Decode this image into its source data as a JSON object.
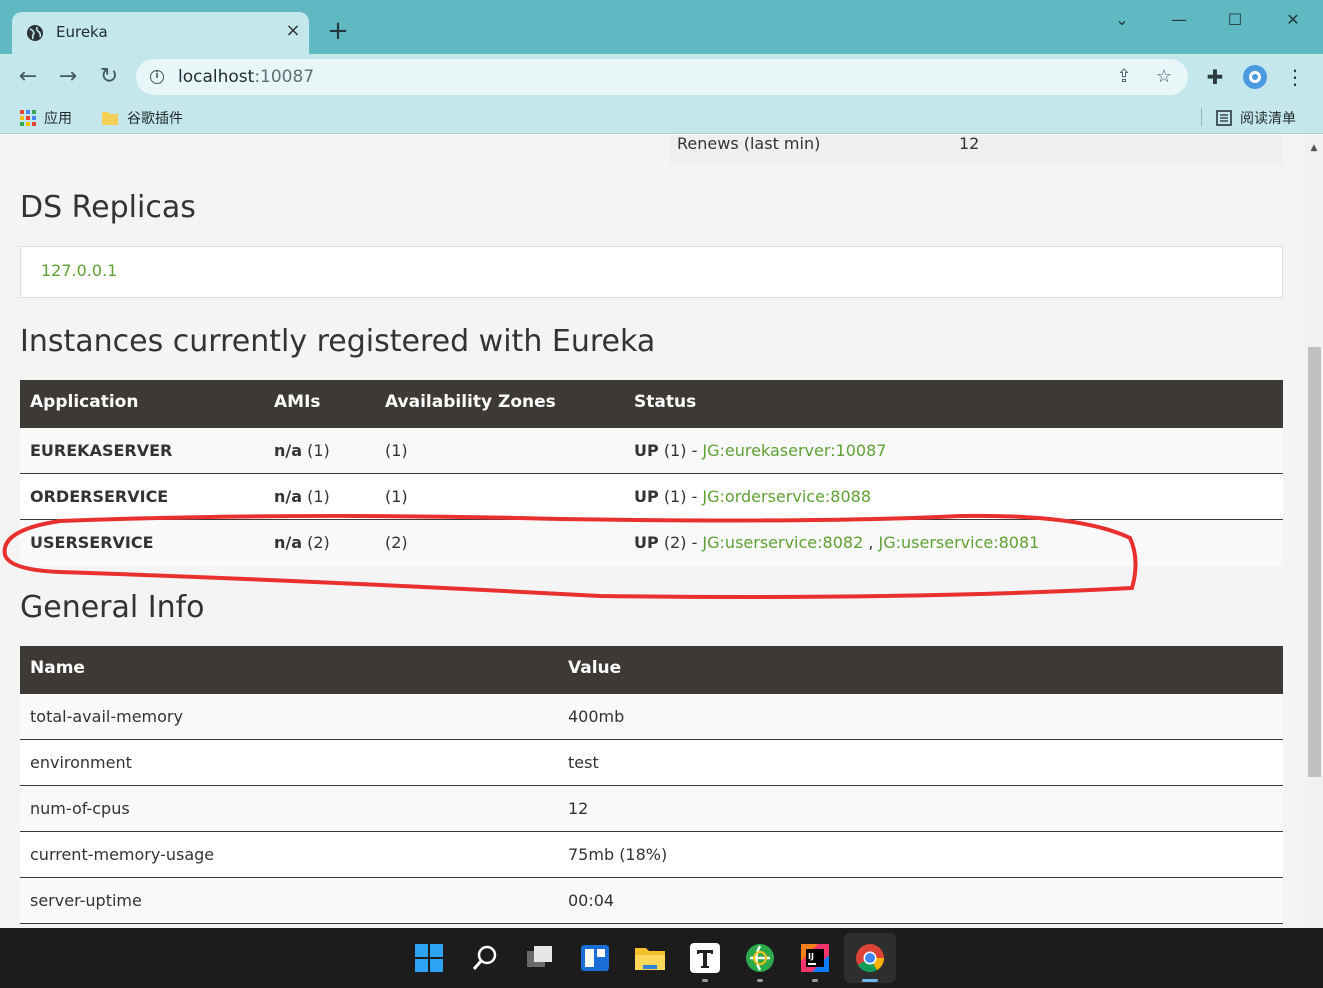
{
  "browser": {
    "tab_title": "Eureka",
    "tab_close": "×",
    "new_tab": "+",
    "window_controls": {
      "minimize": "—",
      "maximize": "☐",
      "close": "✕",
      "tab_search": "⌄"
    },
    "url_host": "localhost",
    "url_port": ":10087",
    "bookmarks": [
      {
        "label": "应用",
        "icon": "apps-grid-icon"
      },
      {
        "label": "谷歌插件",
        "icon": "folder-icon"
      }
    ],
    "reading_list": "阅读清单"
  },
  "page": {
    "renews_label": "Renews (last min)",
    "renews_value": "12",
    "ds_replicas_title": "DS Replicas",
    "replica_host": "127.0.0.1",
    "instances_title": "Instances currently registered with Eureka",
    "instances_headers": [
      "Application",
      "AMIs",
      "Availability Zones",
      "Status"
    ],
    "instances": [
      {
        "app": "EUREKASERVER",
        "amis_n": "n/a",
        "amis_c": "(1)",
        "zones": "(1)",
        "status_up": "UP",
        "status_c": "(1) - ",
        "links": [
          "JG:eurekaserver:10087"
        ]
      },
      {
        "app": "ORDERSERVICE",
        "amis_n": "n/a",
        "amis_c": "(1)",
        "zones": "(1)",
        "status_up": "UP",
        "status_c": "(1) - ",
        "links": [
          "JG:orderservice:8088"
        ]
      },
      {
        "app": "USERSERVICE",
        "amis_n": "n/a",
        "amis_c": "(2)",
        "zones": "(2)",
        "status_up": "UP",
        "status_c": "(2) - ",
        "links": [
          "JG:userservice:8082",
          "JG:userservice:8081"
        ],
        "sep": " , "
      }
    ],
    "general_title": "General Info",
    "general_headers": [
      "Name",
      "Value"
    ],
    "general": [
      {
        "name": "total-avail-memory",
        "value": "400mb"
      },
      {
        "name": "environment",
        "value": "test"
      },
      {
        "name": "num-of-cpus",
        "value": "12"
      },
      {
        "name": "current-memory-usage",
        "value": "75mb (18%)"
      },
      {
        "name": "server-uptime",
        "value": "00:04"
      }
    ]
  },
  "colors": {
    "link": "#5fa134",
    "header": "#3d3935",
    "chrome": "#5fb8c2",
    "annotation": "#e8312f"
  }
}
